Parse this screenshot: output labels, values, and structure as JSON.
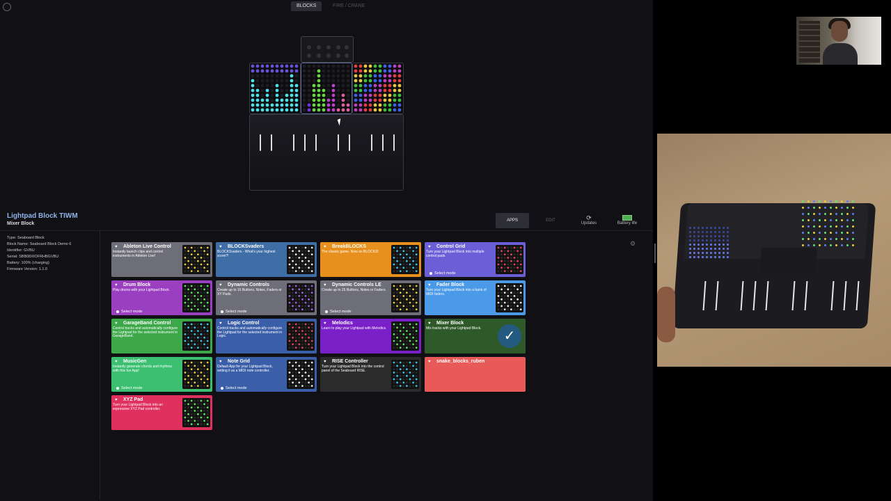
{
  "tabs": {
    "blocks": "BLOCKS",
    "other": "FIRE / CRANE"
  },
  "panel": {
    "title": "Lightpad Block TIWM",
    "subtitle": "Mixer Block",
    "info": [
      "Type: Seaboard Block",
      "Block Name: Seaboard Block Demo 6",
      "Identifier: GVBU",
      "Serial: SBB08XIOFRHBGVBU",
      "Battery: 100% (charging)",
      "Firmware Version: 1.1.0"
    ]
  },
  "toolbar": {
    "apps": "APPS",
    "edit": "EDIT",
    "updates": "Updates",
    "battery": "Battery life"
  },
  "colors": {
    "accent": "#8fb4e8"
  },
  "apps": [
    {
      "title": "Ableton Live Control",
      "desc": "Instantly launch clips and control instruments in Ableton Live!",
      "mode": "",
      "color": "#6e6e78"
    },
    {
      "title": "BLOCKSvaders",
      "desc": "BLOCKSvaders - What's your highest score?!",
      "mode": "",
      "color": "#3f6da6"
    },
    {
      "title": "BreakBLOCKS",
      "desc": "The classic game. Now on BLOCKS!",
      "mode": "",
      "color": "#e8901e"
    },
    {
      "title": "Control Grid",
      "desc": "Turn your Lightpad Block into multiple control pads.",
      "mode": "Select mode",
      "color": "#6b5fd8"
    },
    {
      "title": "Drum Block",
      "desc": "Play drums with your Lightpad Block.",
      "mode": "Select mode",
      "color": "#9a3fc0"
    },
    {
      "title": "Dynamic Controls",
      "desc": "Create up to 16 Buttons, Notes, Faders or XY Pads.",
      "mode": "Select mode",
      "color": "#6e6e78"
    },
    {
      "title": "Dynamic Controls LE",
      "desc": "Create up to 25 Buttons, Notes or Faders.",
      "mode": "Select mode",
      "color": "#6e6e78"
    },
    {
      "title": "Fader Block",
      "desc": "Turn your Lightpad Block into a bank of MIDI faders.",
      "mode": "",
      "color": "#4a9ae8"
    },
    {
      "title": "GarageBand Control",
      "desc": "Control tracks and automatically configure the Lightpad for the selected instrument in GarageBand.",
      "mode": "",
      "color": "#3ca84a"
    },
    {
      "title": "Logic Control",
      "desc": "Control tracks and automatically configure the Lightpad for the selected instrument in Logic.",
      "mode": "",
      "color": "#3a5ea8"
    },
    {
      "title": "Melodics",
      "desc": "Learn to play your Lightpad with Melodics.",
      "mode": "",
      "color": "#7a20c8"
    },
    {
      "title": "Mixer Block",
      "desc": "Mix tracks with your Lightpad Block.",
      "mode": "",
      "color": "#2e5a2a"
    },
    {
      "title": "MusicGen",
      "desc": "Instantly generate chords and rhythms with this fun App!",
      "mode": "Select mode",
      "color": "#3cbf70"
    },
    {
      "title": "Note Grid",
      "desc": "Default App for your Lightpad Block, setting it as a MIDI note controller.",
      "mode": "Select mode",
      "color": "#3a5ea8"
    },
    {
      "title": "RISE Controller",
      "desc": "Turn your Lightpad Block into the control panel of the Seaboard RISE.",
      "mode": "",
      "color": "#2b2b2b"
    },
    {
      "title": "snake_blocks_ruben",
      "desc": "",
      "mode": "",
      "color": "#e85a58"
    },
    {
      "title": "XYZ Pad",
      "desc": "Turn your Lightpad Block into an expressive XYZ Pad controller.",
      "mode": "",
      "color": "#e0305e"
    }
  ]
}
